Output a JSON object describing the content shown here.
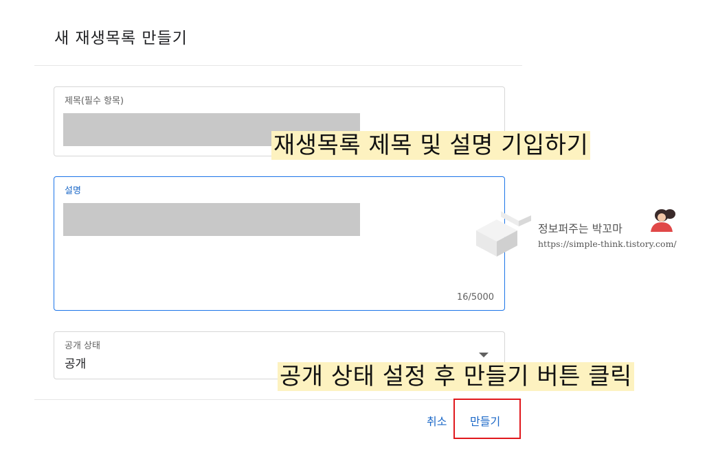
{
  "dialog": {
    "title": "새 재생목록 만들기"
  },
  "fields": {
    "title": {
      "label": "제목(필수 항목)"
    },
    "description": {
      "label": "설명",
      "counter": "16/5000"
    },
    "privacy": {
      "label": "공개 상태",
      "value": "공개"
    }
  },
  "buttons": {
    "cancel": "취소",
    "create": "만들기"
  },
  "annotations": {
    "step1": "재생목록 제목 및 설명 기입하기",
    "step2": "공개 상태 설정 후 만들기 버튼 클릭"
  },
  "watermark": {
    "name": "정보퍼주는 박꼬마",
    "url": "https://simple-think.tistory.com/"
  },
  "colors": {
    "accent": "#1a67c7",
    "highlight_box": "#e0161b",
    "annotation_bg": "#fdf2c0",
    "redaction": "#c8c8c8"
  },
  "icons": {
    "privacy_dropdown": "caret-down-icon",
    "watermark_logo": "block-logo-icon",
    "watermark_avatar": "avatar-icon"
  }
}
